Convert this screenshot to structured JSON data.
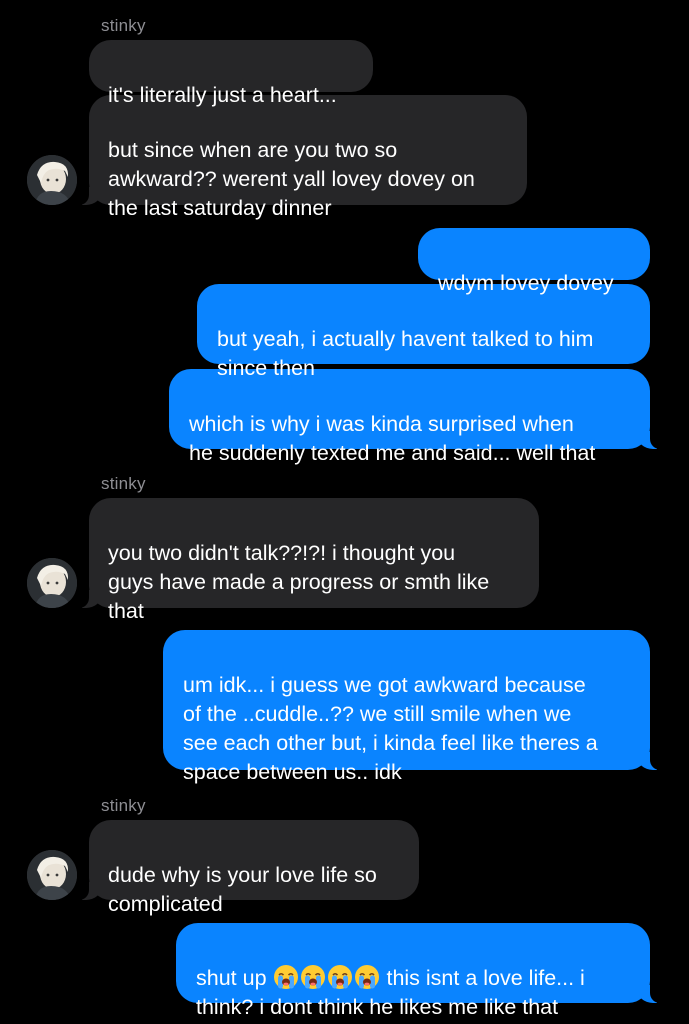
{
  "conversation": {
    "contact_name": "stinky",
    "messages": [
      {
        "from": "them",
        "text": "it's literally just a heart..."
      },
      {
        "from": "them",
        "text": "but since when are you two so\nawkward?? werent yall lovey dovey on\nthe last saturday dinner"
      },
      {
        "from": "me",
        "text": "wdym lovey dovey"
      },
      {
        "from": "me",
        "text": "but yeah, i actually havent talked to him\nsince then"
      },
      {
        "from": "me",
        "text": "which is why i was kinda surprised when\nhe suddenly texted me and said... well that"
      },
      {
        "from": "them",
        "text": "you two didn't talk??!?! i thought you\nguys have made a progress or smth like\nthat"
      },
      {
        "from": "me",
        "text": "um idk... i guess we got awkward because\nof the ..cuddle..?? we still smile when we\nsee each other but, i kinda feel like theres a\nspace between us.. idk"
      },
      {
        "from": "them",
        "text": "dude why is your love life so\ncomplicated"
      },
      {
        "from": "me",
        "text_before_emoji": "shut up ",
        "emoji": "loudly-crying-face",
        "emoji_count": 4,
        "text_after_emoji": " this isnt a love life... i\nthink? i dont think he likes me like that"
      }
    ]
  },
  "colors": {
    "background": "#000000",
    "incoming_bubble": "#262628",
    "outgoing_bubble": "#0a84ff",
    "sender_label": "#8e8e93",
    "text": "#ffffff"
  }
}
